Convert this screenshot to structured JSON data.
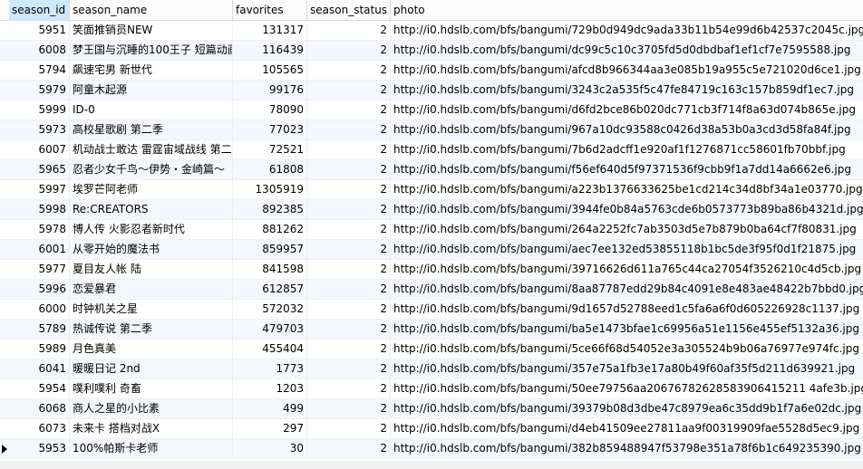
{
  "columns": [
    "season_id",
    "season_name",
    "favorites",
    "season_status",
    "photo"
  ],
  "selected_column": "season_id",
  "current_row_index": 22,
  "rows": [
    {
      "season_id": "5951",
      "season_name": "笑面推销员NEW",
      "favorites": "131317",
      "season_status": "2",
      "photo": "http://i0.hdslb.com/bfs/bangumi/729b0d949dc9ada33b11b54e99d6b42537c2045c.jpg"
    },
    {
      "season_id": "6008",
      "season_name": "梦王国与沉睡的100王子 短篇动画",
      "favorites": "116439",
      "season_status": "2",
      "photo": "http://i0.hdslb.com/bfs/bangumi/dc99c5c10c3705fd5d0dbdbaf1ef1cf7e7595588.jpg"
    },
    {
      "season_id": "5794",
      "season_name": "飙速宅男 新世代",
      "favorites": "105565",
      "season_status": "2",
      "photo": "http://i0.hdslb.com/bfs/bangumi/afcd8b966344aa3e085b19a955c5e721020d6ce1.jpg"
    },
    {
      "season_id": "5979",
      "season_name": "阿童木起源",
      "favorites": "99176",
      "season_status": "2",
      "photo": "http://i0.hdslb.com/bfs/bangumi/3243c2a535f5c47fe84719c163c157b859df1ec7.jpg"
    },
    {
      "season_id": "5999",
      "season_name": "ID-0",
      "favorites": "78090",
      "season_status": "2",
      "photo": "http://i0.hdslb.com/bfs/bangumi/d6fd2bce86b020dc771cb3f714f8a63d074b865e.jpg"
    },
    {
      "season_id": "5973",
      "season_name": "高校星歌剧 第二季",
      "favorites": "77023",
      "season_status": "2",
      "photo": "http://i0.hdslb.com/bfs/bangumi/967a10dc93588c0426d38a53b0a3cd3d58fa84f.jpg"
    },
    {
      "season_id": "6007",
      "season_name": "机动战士敢达 雷霆宙域战线 第二季",
      "favorites": "72521",
      "season_status": "2",
      "photo": "http://i0.hdslb.com/bfs/bangumi/7b6d2adcff1e920af1f1276871cc58601fb70bbf.jpg"
    },
    {
      "season_id": "5965",
      "season_name": "忍者少女千鸟～伊势・金崎篇～",
      "favorites": "61808",
      "season_status": "2",
      "photo": "http://i0.hdslb.com/bfs/bangumi/f56ef640d5f97371536f9cbb9f1a7dd14a6662e6.jpg"
    },
    {
      "season_id": "5997",
      "season_name": "埃罗芒阿老师",
      "favorites": "1305919",
      "season_status": "2",
      "photo": "http://i0.hdslb.com/bfs/bangumi/a223b1376633625be1cd214c34d8bf34a1e03770.jpg"
    },
    {
      "season_id": "5998",
      "season_name": "Re:CREATORS",
      "favorites": "892385",
      "season_status": "2",
      "photo": "http://i0.hdslb.com/bfs/bangumi/3944fe0b84a5763cde6b0573773b89ba86b4321d.jpg"
    },
    {
      "season_id": "5978",
      "season_name": "博人传 火影忍者新时代",
      "favorites": "881262",
      "season_status": "2",
      "photo": "http://i0.hdslb.com/bfs/bangumi/264a2252fc7ab3503d5e7b879b0ba64cf7f80831.jpg"
    },
    {
      "season_id": "6001",
      "season_name": "从零开始的魔法书",
      "favorites": "859957",
      "season_status": "2",
      "photo": "http://i0.hdslb.com/bfs/bangumi/aec7ee132ed53855118b1bc5de3f95f0d1f21875.jpg"
    },
    {
      "season_id": "5977",
      "season_name": "夏目友人帐 陆",
      "favorites": "841598",
      "season_status": "2",
      "photo": "http://i0.hdslb.com/bfs/bangumi/39716626d611a765c44ca27054f3526210c4d5cb.jpg"
    },
    {
      "season_id": "5996",
      "season_name": "恋爱暴君",
      "favorites": "612857",
      "season_status": "2",
      "photo": "http://i0.hdslb.com/bfs/bangumi/8aa87787edd29b84c4091e8e483ae48422b7bbd0.jpg"
    },
    {
      "season_id": "6000",
      "season_name": "时钟机关之星",
      "favorites": "572032",
      "season_status": "2",
      "photo": "http://i0.hdslb.com/bfs/bangumi/9d1657d52788eed1c5fa6a6f0d605226928c1137.jpg"
    },
    {
      "season_id": "5789",
      "season_name": "热诚传说 第二季",
      "favorites": "479703",
      "season_status": "2",
      "photo": "http://i0.hdslb.com/bfs/bangumi/ba5e1473bfae1c69956a51e1156e455ef5132a36.jpg"
    },
    {
      "season_id": "5989",
      "season_name": "月色真美",
      "favorites": "455404",
      "season_status": "2",
      "photo": "http://i0.hdslb.com/bfs/bangumi/5ce66f68d54052e3a305524b9b06a76977e974fc.jpg"
    },
    {
      "season_id": "6041",
      "season_name": "暖暖日记 2nd",
      "favorites": "1773",
      "season_status": "2",
      "photo": "http://i0.hdslb.com/bfs/bangumi/357e75a1fb3e17a80b49f60af35f5d211d639921.jpg"
    },
    {
      "season_id": "5954",
      "season_name": "噗利噗利 奇畜",
      "favorites": "1203",
      "season_status": "2",
      "photo": "http://i0.hdslb.com/bfs/bangumi/50ee79756aa20676782628583906415211 4afe3b.jpg"
    },
    {
      "season_id": "6068",
      "season_name": "商人之星的小比素",
      "favorites": "499",
      "season_status": "2",
      "photo": "http://i0.hdslb.com/bfs/bangumi/39379b08d3dbe47c8979ea6c35dd9b1f7a6e02dc.jpg"
    },
    {
      "season_id": "6073",
      "season_name": "未来卡 搭档对战X",
      "favorites": "297",
      "season_status": "2",
      "photo": "http://i0.hdslb.com/bfs/bangumi/d4eb41509ee27811aa9f00319909fae5528d5ec9.jpg"
    },
    {
      "season_id": "5953",
      "season_name": "100%帕斯卡老师",
      "favorites": "30",
      "season_status": "2",
      "photo": "http://i0.hdslb.com/bfs/bangumi/382b859488947f53798e351a78f6b1c649235390.jpg"
    }
  ],
  "icons": {
    "current_row_indicator": "row-pointer-icon"
  },
  "colors": {
    "selected_header": "#cde8ff",
    "alt_row": "#f4f7fd",
    "grid_line": "#eceef1"
  }
}
